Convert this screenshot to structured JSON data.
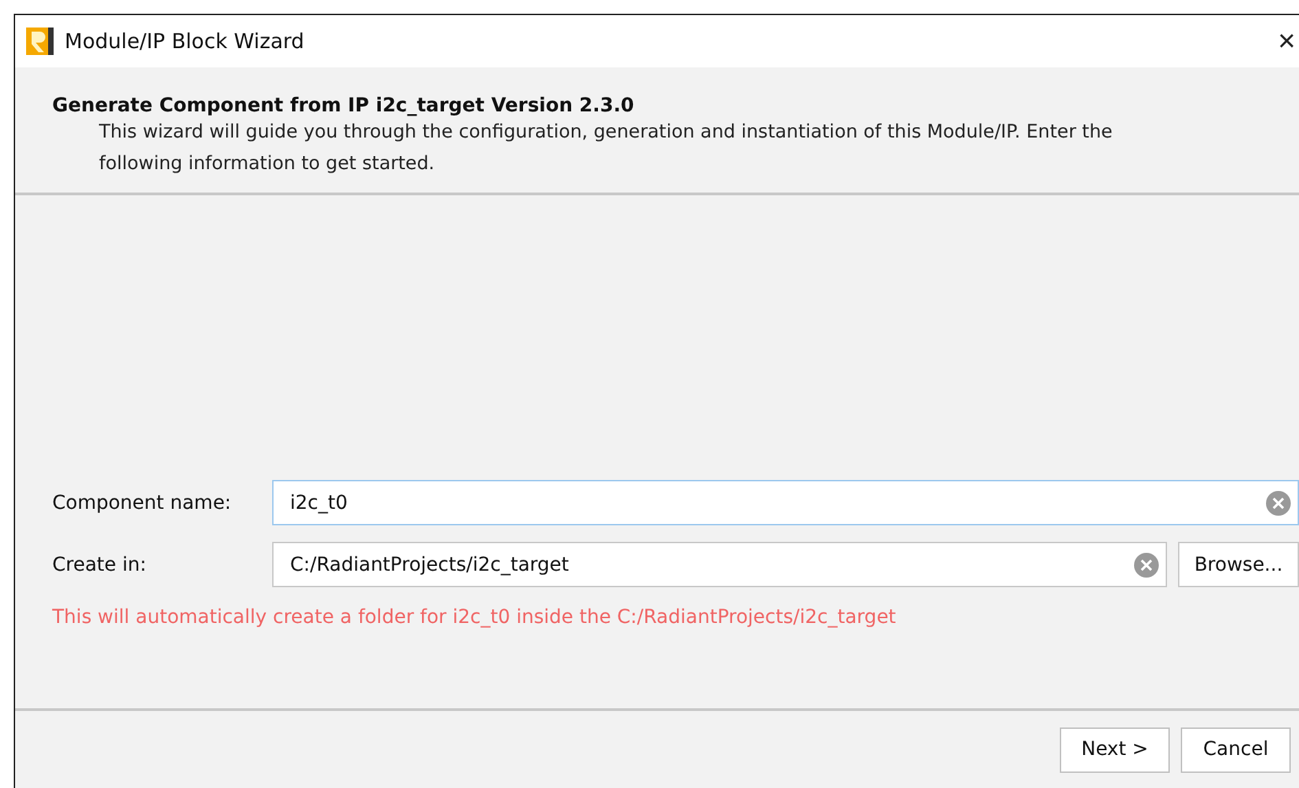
{
  "window": {
    "title": "Module/IP Block Wizard",
    "close": "×"
  },
  "header": {
    "title": "Generate Component from IP i2c_target Version 2.3.0",
    "description": "This wizard will guide you through the configuration, generation and instantiation of this Module/IP. Enter the following information to get started."
  },
  "form": {
    "fields": [
      {
        "label": "Component name:",
        "value": "i2c_t0",
        "focused": true
      },
      {
        "label": "Create in:",
        "value": "C:/RadiantProjects/i2c_target",
        "focused": false,
        "browse": "Browse..."
      }
    ],
    "message": "This will automatically create a folder for i2c_t0 inside the C:/RadiantProjects/i2c_target"
  },
  "buttons": [
    "Next >",
    "Cancel"
  ]
}
